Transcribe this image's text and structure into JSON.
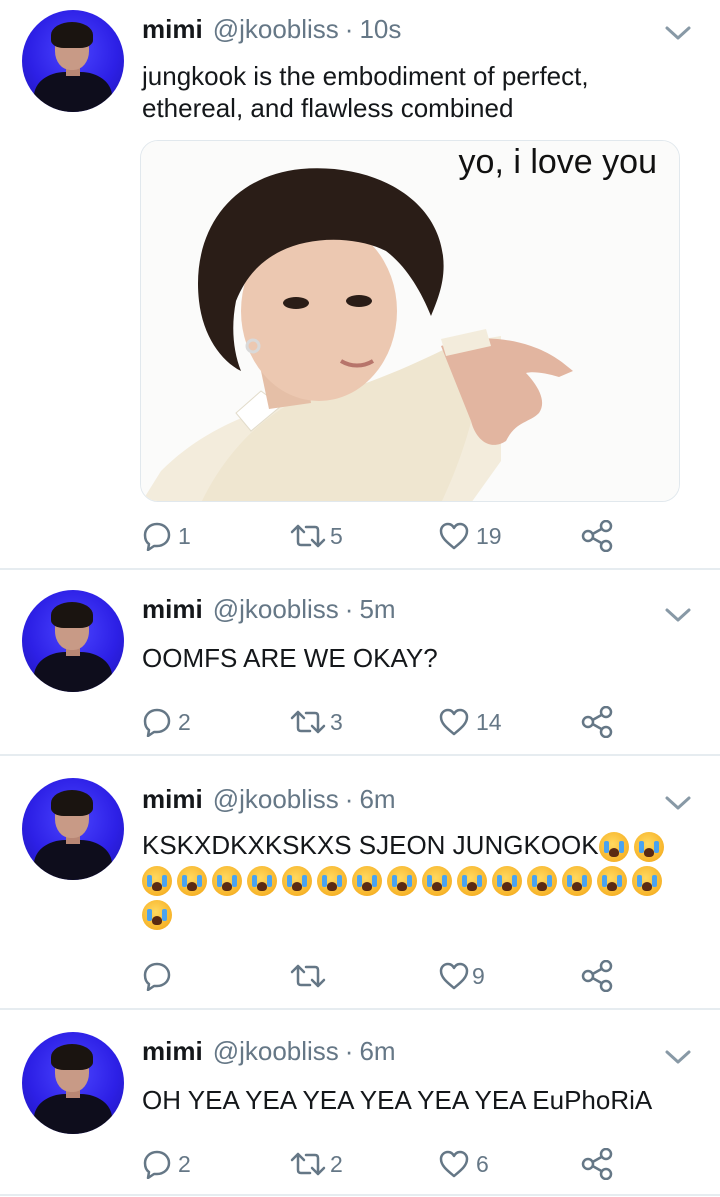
{
  "tweets": [
    {
      "name": "mimi",
      "handle": "@jkoobliss",
      "sep": "·",
      "time": "10s",
      "text": "jungkook is the embodiment of perfect, ethereal, and flawless combined",
      "media_caption": "yo, i love you",
      "replies": "1",
      "retweets": "5",
      "likes": "19"
    },
    {
      "name": "mimi",
      "handle": "@jkoobliss",
      "sep": "·",
      "time": "5m",
      "text": "OOMFS ARE WE OKAY?",
      "replies": "2",
      "retweets": "3",
      "likes": "14"
    },
    {
      "name": "mimi",
      "handle": "@jkoobliss",
      "sep": "·",
      "time": "6m",
      "text": "KSKXDKXKSKXS SJEON JUNGKOOK",
      "emoji": "loudly-crying-face",
      "replies": "",
      "retweets": "",
      "likes": "9"
    },
    {
      "name": "mimi",
      "handle": "@jkoobliss",
      "sep": "·",
      "time": "6m",
      "text": "OH YEA YEA YEA YEA YEA YEA EuPhoRiA",
      "replies": "2",
      "retweets": "2",
      "likes": "6"
    }
  ],
  "icons": {
    "reply": "reply-icon",
    "retweet": "retweet-icon",
    "like": "heart-icon",
    "share": "share-icon",
    "more": "chevron-down-icon"
  },
  "colors": {
    "text": "#14171a",
    "secondary": "#657786",
    "divider": "#e6ecf0",
    "avatar_bg": "#2d20e6"
  }
}
